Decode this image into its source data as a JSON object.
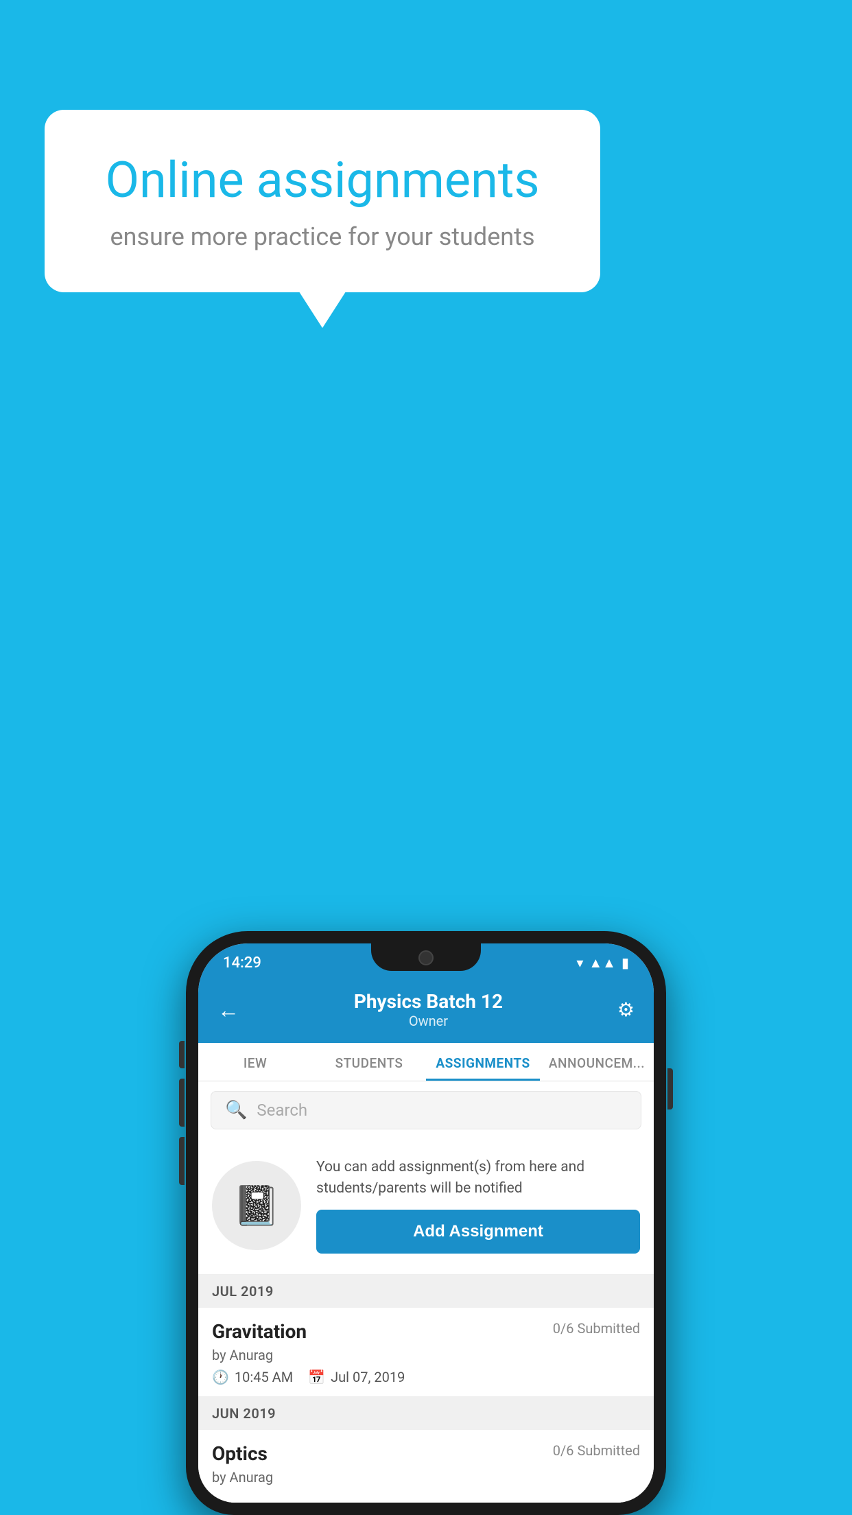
{
  "background_color": "#1ab8e8",
  "speech_bubble": {
    "title": "Online assignments",
    "subtitle": "ensure more practice for your students"
  },
  "status_bar": {
    "time": "14:29",
    "icons": [
      "wifi",
      "signal",
      "battery"
    ]
  },
  "header": {
    "title": "Physics Batch 12",
    "subtitle": "Owner",
    "back_label": "←",
    "settings_label": "⚙"
  },
  "tabs": [
    {
      "id": "overview",
      "label": "IEW"
    },
    {
      "id": "students",
      "label": "STUDENTS"
    },
    {
      "id": "assignments",
      "label": "ASSIGNMENTS",
      "active": true
    },
    {
      "id": "announcements",
      "label": "ANNOUNCEM..."
    }
  ],
  "search": {
    "placeholder": "Search"
  },
  "add_assignment_section": {
    "description": "You can add assignment(s) from here and students/parents will be notified",
    "button_label": "Add Assignment"
  },
  "sections": [
    {
      "id": "jul2019",
      "header": "JUL 2019",
      "items": [
        {
          "name": "Gravitation",
          "submitted": "0/6 Submitted",
          "by": "by Anurag",
          "time": "10:45 AM",
          "date": "Jul 07, 2019"
        }
      ]
    },
    {
      "id": "jun2019",
      "header": "JUN 2019",
      "items": [
        {
          "name": "Optics",
          "submitted": "0/6 Submitted",
          "by": "by Anurag",
          "time": "",
          "date": ""
        }
      ]
    }
  ]
}
